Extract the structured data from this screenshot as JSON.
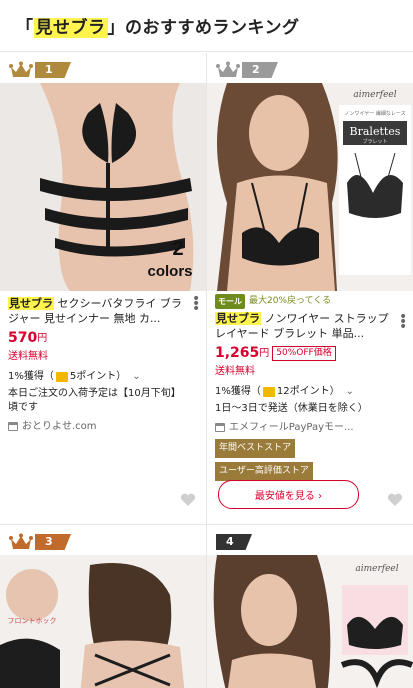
{
  "header": {
    "quote_open": "「",
    "keyword": "見せブラ",
    "rest": "」のおすすめランキング"
  },
  "items": [
    {
      "rank": "1",
      "image_text": "2\ncolors",
      "image_text_1": "2",
      "image_text_2": "colors",
      "tag": "見せブラ",
      "name": " セクシーバタフライ ブラジャー 見せインナー 無地 カ...",
      "price": "570",
      "price_unit": "円",
      "shipping": "送料無料",
      "points_prefix": "1%獲得（",
      "points_suffix": "5ポイント）",
      "delivery": "本日ご注文の入荷予定は【10月下旬】頃です",
      "store": "おとりよせ.com"
    },
    {
      "rank": "2",
      "mall_label": "モール",
      "mall_text": "最大20%戻ってくる",
      "brand": "aimerfeel",
      "brand_sub": "ノンワイヤー 繊細なレース",
      "image_title": "Bralettes",
      "image_sub": "ブラレット",
      "tag": "見せブラ",
      "name": " ノンワイヤー ストラップレイヤード ブラレット 単品...",
      "price": "1,265",
      "price_unit": "円",
      "off": "50%OFF価格",
      "shipping": "送料無料",
      "points_prefix": "1%獲得（",
      "points_suffix": "12ポイント）",
      "delivery": "1日〜3日で発送（休業日を除く）",
      "store": "エメフィールPayPayモー...",
      "badges": [
        "年間ベストストア",
        "ユーザー高評価ストア"
      ],
      "button": "最安値を見る ›"
    },
    {
      "rank": "3",
      "image_text": "フロントホック"
    },
    {
      "rank": "4",
      "brand": "aimerfeel"
    }
  ],
  "colors": {
    "accent": "#d8002d",
    "highlight": "#fff34d",
    "gold": "#b08a3c",
    "silver": "#9a9a9a",
    "bronze": "#c06a2b"
  }
}
